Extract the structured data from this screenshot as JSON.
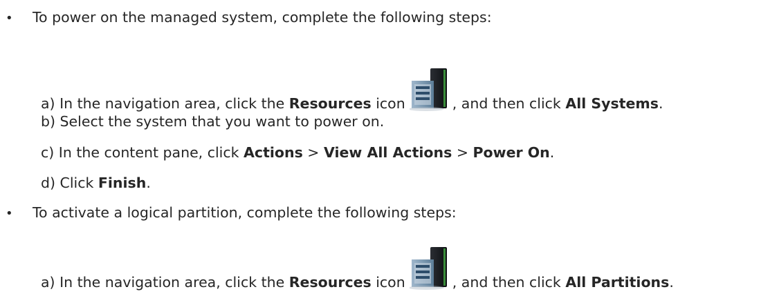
{
  "sections": [
    {
      "bullet": "•",
      "intro": "To power on the managed system, complete the following steps:",
      "steps": [
        {
          "prefix": "a) In the navigation area, click the ",
          "b1": "Resources",
          "mid": " icon",
          "mid2": ", and then click ",
          "b2": "All Systems",
          "suffix": "."
        },
        {
          "text": "b) Select the system that you want to power on."
        },
        {
          "prefix": "c) In the content pane, click ",
          "b1": "Actions",
          "sep1": " > ",
          "b2": "View All Actions",
          "sep2": " > ",
          "b3": "Power On",
          "suffix": "."
        },
        {
          "prefix": "d) Click ",
          "b1": "Finish",
          "suffix": "."
        }
      ]
    },
    {
      "bullet": "•",
      "intro": "To activate a logical partition, complete the following steps:",
      "steps": [
        {
          "prefix": "a) In the navigation area, click the ",
          "b1": "Resources",
          "mid": " icon",
          "mid2": ", and then click ",
          "b2": "All Partitions",
          "suffix": "."
        }
      ]
    }
  ],
  "icons": {
    "resources": "resources-server-icon"
  }
}
